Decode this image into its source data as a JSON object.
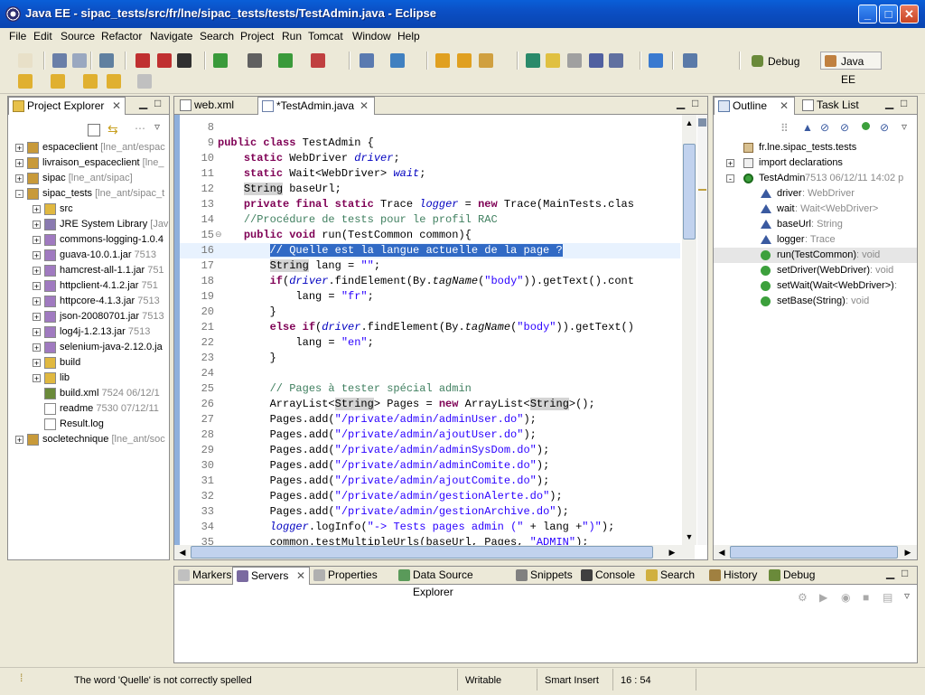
{
  "window": {
    "title": "Java EE - sipac_tests/src/fr/lne/sipac_tests/tests/TestAdmin.java - Eclipse"
  },
  "menu": [
    "File",
    "Edit",
    "Source",
    "Refactor",
    "Navigate",
    "Search",
    "Project",
    "Run",
    "Tomcat",
    "Window",
    "Help"
  ],
  "perspectives": [
    {
      "label": "Debug"
    },
    {
      "label": "Java EE"
    }
  ],
  "explorer": {
    "title": "Project Explorer",
    "items": [
      {
        "level": 0,
        "exp": "+",
        "name": "espaceclient",
        "dim": " [lne_ant/espac",
        "icon": "project"
      },
      {
        "level": 0,
        "exp": "+",
        "name": "livraison_espaceclient",
        "dim": " [lne_",
        "icon": "project"
      },
      {
        "level": 0,
        "exp": "+",
        "name": "sipac",
        "dim": " [lne_ant/sipac]",
        "icon": "project"
      },
      {
        "level": 0,
        "exp": "-",
        "name": "sipac_tests",
        "dim": " [lne_ant/sipac_t",
        "icon": "project"
      },
      {
        "level": 1,
        "exp": "+",
        "name": "src",
        "dim": "",
        "icon": "folder"
      },
      {
        "level": 1,
        "exp": "+",
        "name": "JRE System Library",
        "dim": " [Jav",
        "icon": "lib"
      },
      {
        "level": 1,
        "exp": "+",
        "name": "commons-logging-1.0.4",
        "dim": "",
        "icon": "jar"
      },
      {
        "level": 1,
        "exp": "+",
        "name": "guava-10.0.1.jar",
        "dim": " 7513",
        "icon": "jar"
      },
      {
        "level": 1,
        "exp": "+",
        "name": "hamcrest-all-1.1.jar",
        "dim": " 751",
        "icon": "jar"
      },
      {
        "level": 1,
        "exp": "+",
        "name": "httpclient-4.1.2.jar",
        "dim": " 751",
        "icon": "jar"
      },
      {
        "level": 1,
        "exp": "+",
        "name": "httpcore-4.1.3.jar",
        "dim": " 7513",
        "icon": "jar"
      },
      {
        "level": 1,
        "exp": "+",
        "name": "json-20080701.jar",
        "dim": " 7513",
        "icon": "jar"
      },
      {
        "level": 1,
        "exp": "+",
        "name": "log4j-1.2.13.jar",
        "dim": " 7513",
        "icon": "jar"
      },
      {
        "level": 1,
        "exp": "+",
        "name": "selenium-java-2.12.0.ja",
        "dim": "",
        "icon": "jar"
      },
      {
        "level": 1,
        "exp": "+",
        "name": "build",
        "dim": "",
        "icon": "folder"
      },
      {
        "level": 1,
        "exp": "+",
        "name": "lib",
        "dim": "",
        "icon": "folder"
      },
      {
        "level": 1,
        "exp": "",
        "name": "build.xml",
        "dim": " 7524  06/12/1",
        "icon": "xml"
      },
      {
        "level": 1,
        "exp": "",
        "name": "readme",
        "dim": " 7530  07/12/11",
        "icon": "file"
      },
      {
        "level": 1,
        "exp": "",
        "name": "Result.log",
        "dim": "",
        "icon": "file"
      },
      {
        "level": 0,
        "exp": "+",
        "name": "socletechnique",
        "dim": " [lne_ant/soc",
        "icon": "project"
      }
    ]
  },
  "editor": {
    "tabs": [
      {
        "label": "web.xml",
        "active": false
      },
      {
        "label": "*TestAdmin.java",
        "active": true
      }
    ],
    "line_numbers": [
      "8",
      "9",
      "10",
      "11",
      "12",
      "13",
      "14",
      "15",
      "16",
      "17",
      "18",
      "19",
      "20",
      "21",
      "22",
      "23",
      "24",
      "25",
      "26",
      "27",
      "28",
      "29",
      "30",
      "31",
      "32",
      "33",
      "34",
      "35"
    ],
    "lines": [
      [],
      [
        [
          "kw",
          "public class "
        ],
        [
          "",
          "TestAdmin {"
        ]
      ],
      [
        [
          "",
          "    "
        ],
        [
          "kw",
          "static "
        ],
        [
          "",
          "WebDriver "
        ],
        [
          "fd",
          "driver"
        ],
        [
          "",
          ";"
        ]
      ],
      [
        [
          "",
          "    "
        ],
        [
          "kw",
          "static "
        ],
        [
          "",
          "Wait<WebDriver> "
        ],
        [
          "fd",
          "wait"
        ],
        [
          "",
          ";"
        ]
      ],
      [
        [
          "",
          "    "
        ],
        [
          "hl",
          "String"
        ],
        [
          "",
          " baseUrl;"
        ]
      ],
      [
        [
          "",
          "    "
        ],
        [
          "kw",
          "private final static "
        ],
        [
          "",
          "Trace "
        ],
        [
          "fd",
          "logger"
        ],
        [
          "",
          " = "
        ],
        [
          "kw",
          "new "
        ],
        [
          "",
          "Trace(MainTests.clas"
        ]
      ],
      [
        [
          "",
          "    "
        ],
        [
          "cm",
          "//Procédure de tests pour le profil RAC"
        ]
      ],
      [
        [
          "",
          "    "
        ],
        [
          "kw",
          "public void "
        ],
        [
          "",
          "run(TestCommon common){"
        ]
      ],
      [
        [
          "",
          "        "
        ],
        [
          "sel",
          "// Quelle est la langue actuelle de la page ?"
        ]
      ],
      [
        [
          "",
          "        "
        ],
        [
          "hl",
          "String"
        ],
        [
          "",
          " lang = "
        ],
        [
          "st",
          "\"\""
        ],
        [
          "",
          ";"
        ]
      ],
      [
        [
          "",
          "        "
        ],
        [
          "kw",
          "if"
        ],
        [
          "",
          "("
        ],
        [
          "fd",
          "driver"
        ],
        [
          "",
          ".findElement(By."
        ],
        [
          "it",
          "tagName"
        ],
        [
          "",
          "("
        ],
        [
          "st",
          "\"body\""
        ],
        [
          "",
          "))"
        ],
        [
          "",
          ".getText().cont"
        ]
      ],
      [
        [
          "",
          "            lang = "
        ],
        [
          "st",
          "\"fr\""
        ],
        [
          "",
          ";"
        ]
      ],
      [
        [
          "",
          "        }"
        ]
      ],
      [
        [
          "",
          "        "
        ],
        [
          "kw",
          "else if"
        ],
        [
          "",
          "("
        ],
        [
          "fd",
          "driver"
        ],
        [
          "",
          ".findElement(By."
        ],
        [
          "it",
          "tagName"
        ],
        [
          "",
          "("
        ],
        [
          "st",
          "\"body\""
        ],
        [
          "",
          "))"
        ],
        [
          "",
          ".getText()"
        ]
      ],
      [
        [
          "",
          "            lang = "
        ],
        [
          "st",
          "\"en\""
        ],
        [
          "",
          ";"
        ]
      ],
      [
        [
          "",
          "        }"
        ]
      ],
      [],
      [
        [
          "",
          "        "
        ],
        [
          "cm",
          "// Pages à tester spécial admin"
        ]
      ],
      [
        [
          "",
          "        ArrayList<"
        ],
        [
          "hl",
          "String"
        ],
        [
          "",
          "> Pages = "
        ],
        [
          "kw",
          "new "
        ],
        [
          "",
          "ArrayList<"
        ],
        [
          "hl",
          "String"
        ],
        [
          "",
          ">();"
        ]
      ],
      [
        [
          "",
          "        Pages.add("
        ],
        [
          "st",
          "\"/private/admin/adminUser.do\""
        ],
        [
          "",
          ");"
        ]
      ],
      [
        [
          "",
          "        Pages.add("
        ],
        [
          "st",
          "\"/private/admin/ajoutUser.do\""
        ],
        [
          "",
          ");"
        ]
      ],
      [
        [
          "",
          "        Pages.add("
        ],
        [
          "st",
          "\"/private/admin/adminSysDom.do\""
        ],
        [
          "",
          ");"
        ]
      ],
      [
        [
          "",
          "        Pages.add("
        ],
        [
          "st",
          "\"/private/admin/adminComite.do\""
        ],
        [
          "",
          ");"
        ]
      ],
      [
        [
          "",
          "        Pages.add("
        ],
        [
          "st",
          "\"/private/admin/ajoutComite.do\""
        ],
        [
          "",
          ");"
        ]
      ],
      [
        [
          "",
          "        Pages.add("
        ],
        [
          "st",
          "\"/private/admin/gestionAlerte.do\""
        ],
        [
          "",
          ");"
        ]
      ],
      [
        [
          "",
          "        Pages.add("
        ],
        [
          "st",
          "\"/private/admin/gestionArchive.do\""
        ],
        [
          "",
          ");"
        ]
      ],
      [
        [
          "",
          "        "
        ],
        [
          "fd",
          "logger"
        ],
        [
          "",
          ".logInfo("
        ],
        [
          "st",
          "\"-> Tests pages admin (\""
        ],
        [
          "",
          " + lang +"
        ],
        [
          "st",
          "\")\""
        ],
        [
          "",
          ");"
        ]
      ],
      [
        [
          "",
          "        common.testMultipleUrls(baseUrl, Pages, "
        ],
        [
          "st",
          "\"ADMIN\""
        ],
        [
          "",
          ");"
        ]
      ]
    ]
  },
  "outline": {
    "tabs": [
      {
        "label": "Outline"
      },
      {
        "label": "Task List"
      }
    ],
    "items": [
      {
        "level": 0,
        "exp": "",
        "label": "fr.lne.sipac_tests.tests",
        "type": "",
        "icon": "package"
      },
      {
        "level": 0,
        "exp": "+",
        "label": "import declarations",
        "type": "",
        "icon": "imports"
      },
      {
        "level": 0,
        "exp": "-",
        "label": "TestAdmin",
        "type": " 7513  06/12/11 14:02  p",
        "icon": "class"
      },
      {
        "level": 1,
        "exp": "",
        "label": "driver",
        "type": " : WebDriver",
        "icon": "field-s"
      },
      {
        "level": 1,
        "exp": "",
        "label": "wait",
        "type": " : Wait<WebDriver>",
        "icon": "field-s"
      },
      {
        "level": 1,
        "exp": "",
        "label": "baseUrl",
        "type": " : String",
        "icon": "field"
      },
      {
        "level": 1,
        "exp": "",
        "label": "logger",
        "type": " : Trace",
        "icon": "field-sf"
      },
      {
        "level": 1,
        "exp": "",
        "label": "run(TestCommon)",
        "type": " : void",
        "icon": "method",
        "selected": true
      },
      {
        "level": 1,
        "exp": "",
        "label": "setDriver(WebDriver)",
        "type": " : void",
        "icon": "method"
      },
      {
        "level": 1,
        "exp": "",
        "label": "setWait(Wait<WebDriver>)",
        "type": " :",
        "icon": "method"
      },
      {
        "level": 1,
        "exp": "",
        "label": "setBase(String)",
        "type": " : void",
        "icon": "method"
      }
    ]
  },
  "bottom": {
    "tabs": [
      {
        "label": "Markers",
        "active": false
      },
      {
        "label": "Servers",
        "active": true
      },
      {
        "label": "Properties",
        "active": false
      },
      {
        "label": "Data Source Explorer",
        "active": false
      },
      {
        "label": "Snippets",
        "active": false
      },
      {
        "label": "Console",
        "active": false
      },
      {
        "label": "Search",
        "active": false
      },
      {
        "label": "History",
        "active": false
      },
      {
        "label": "Debug",
        "active": false
      }
    ]
  },
  "status": {
    "message": "The word 'Quelle' is not correctly spelled",
    "writable": "Writable",
    "insert": "Smart Insert",
    "position": "16 : 54"
  },
  "colors": {
    "selection": "#316ac5",
    "current_line": "#e8f2fe"
  }
}
